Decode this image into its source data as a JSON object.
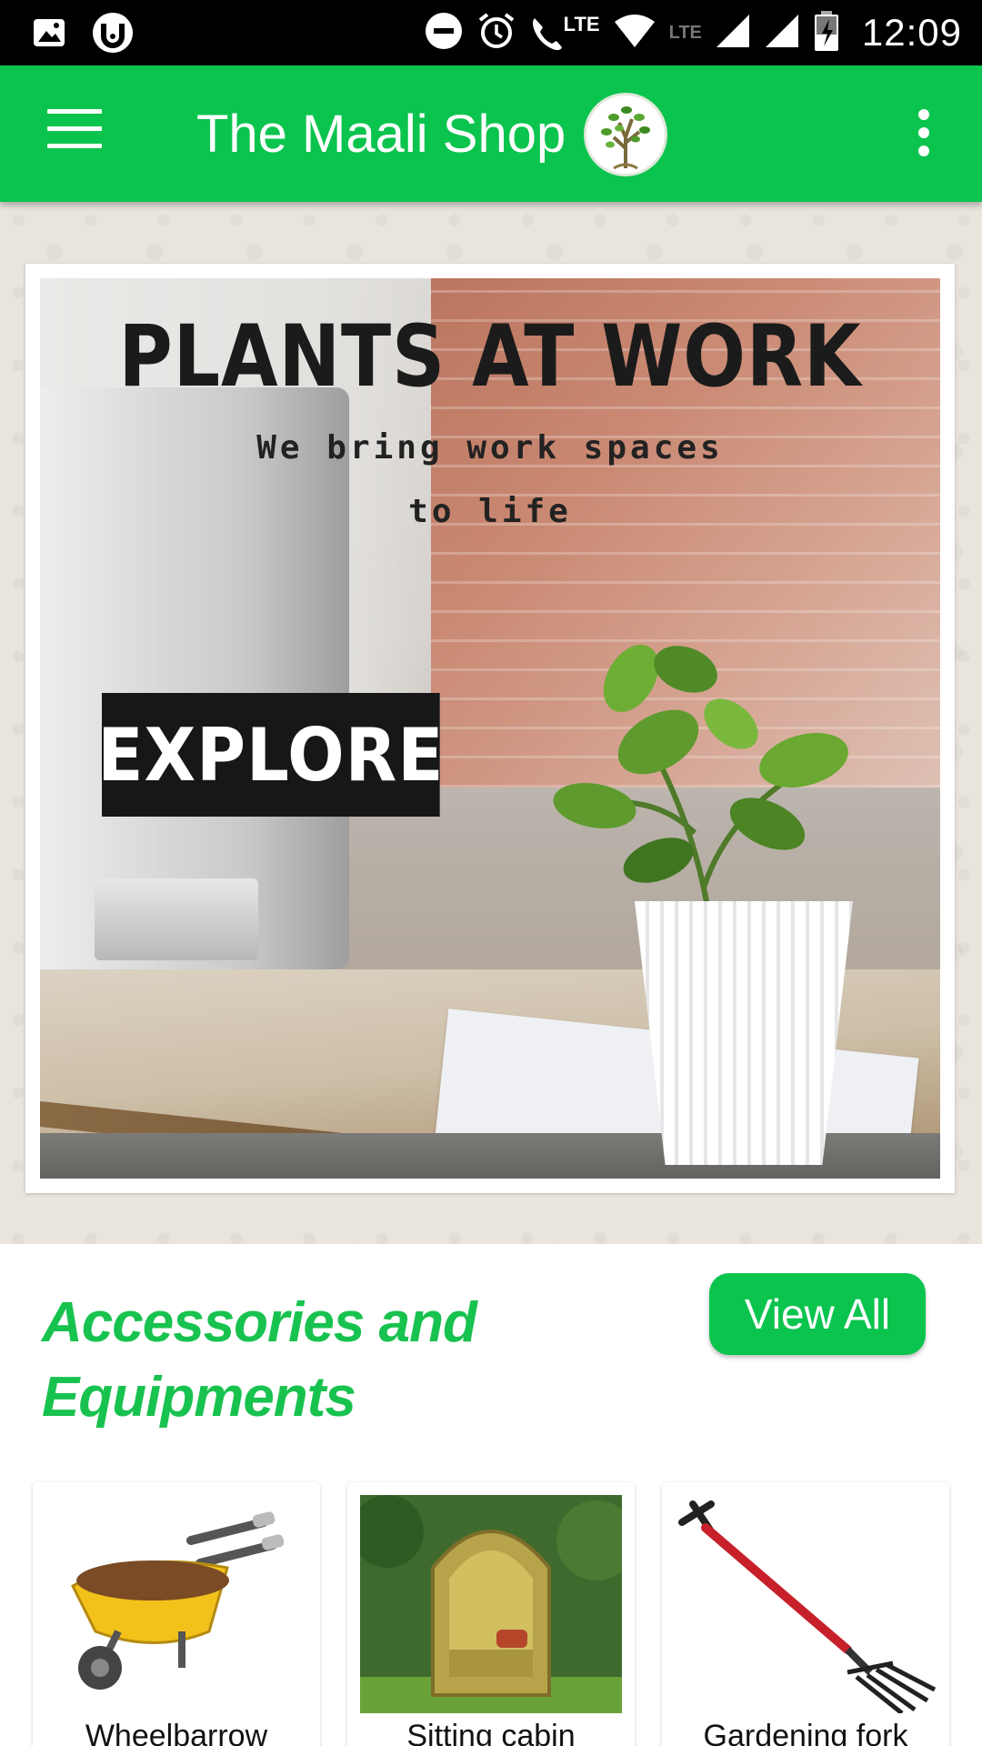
{
  "status_bar": {
    "time": "12:09",
    "network_label": "LTE",
    "icons": [
      "gallery-icon",
      "torrent-icon",
      "dnd-icon",
      "alarm-icon",
      "volte-call-icon",
      "wifi-icon",
      "signal-icon",
      "signal-icon",
      "battery-charging-icon"
    ]
  },
  "app_bar": {
    "title": "The Maali Shop",
    "logo": "tree-logo",
    "menu_icon": "hamburger-menu-icon",
    "overflow_icon": "more-vert-icon"
  },
  "banner": {
    "headline": "PLANTS AT WORK",
    "subline_1": "We bring work spaces",
    "subline_2": "to life",
    "cta_label": "EXPLORE"
  },
  "section": {
    "title": "Accessories and Equipments",
    "view_all_label": "View All",
    "products": [
      {
        "name": "Wheelbarrow"
      },
      {
        "name": "Sitting cabin"
      },
      {
        "name": "Gardening fork"
      }
    ]
  },
  "colors": {
    "brand_green": "#0bc44e",
    "section_title_green": "#18c24f",
    "status_bar": "#000000",
    "banner_background": "#e9e4dc"
  }
}
